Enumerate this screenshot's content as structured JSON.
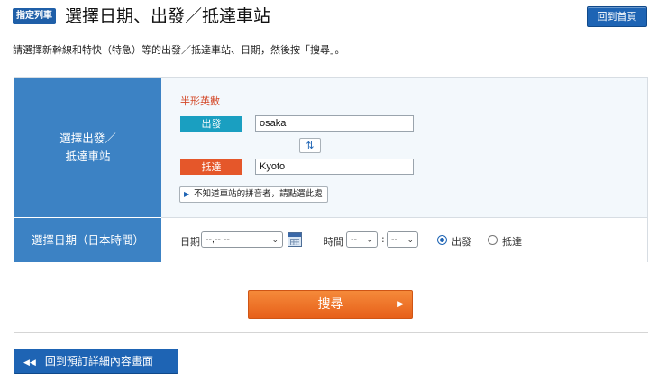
{
  "header": {
    "badge": "指定列車",
    "title": "選擇日期、出發／抵達車站",
    "home_button": "回到首頁"
  },
  "instruction": "請選擇新幹線和特快（特急）等的出發／抵達車站、日期，然後按「搜尋」。",
  "station_section": {
    "label_line1": "選擇出發／",
    "label_line2": "抵達車站",
    "hint": "半形英數",
    "departure_tag": "出發",
    "departure_value": "osaka",
    "arrival_tag": "抵達",
    "arrival_value": "Kyoto",
    "swap_icon": "⇅",
    "help_link": "不知道車站的拼音者，請點選此處"
  },
  "date_section": {
    "label": "選擇日期（日本時間）",
    "date_label": "日期",
    "date_value": "--,-- --",
    "time_label": "時間",
    "hour_value": "--",
    "minute_value": "--",
    "colon": ":",
    "radio_departure": "出發",
    "radio_arrival": "抵達",
    "selected_radio": "departure"
  },
  "search_button": "搜尋",
  "back_button": "回到預訂詳細內容畫面",
  "colors": {
    "primary_blue": "#1e64b4",
    "label_blue": "#3c82c4",
    "departure_teal": "#1a9fc1",
    "arrival_orange": "#e5572a",
    "search_orange": "#ee7426"
  }
}
